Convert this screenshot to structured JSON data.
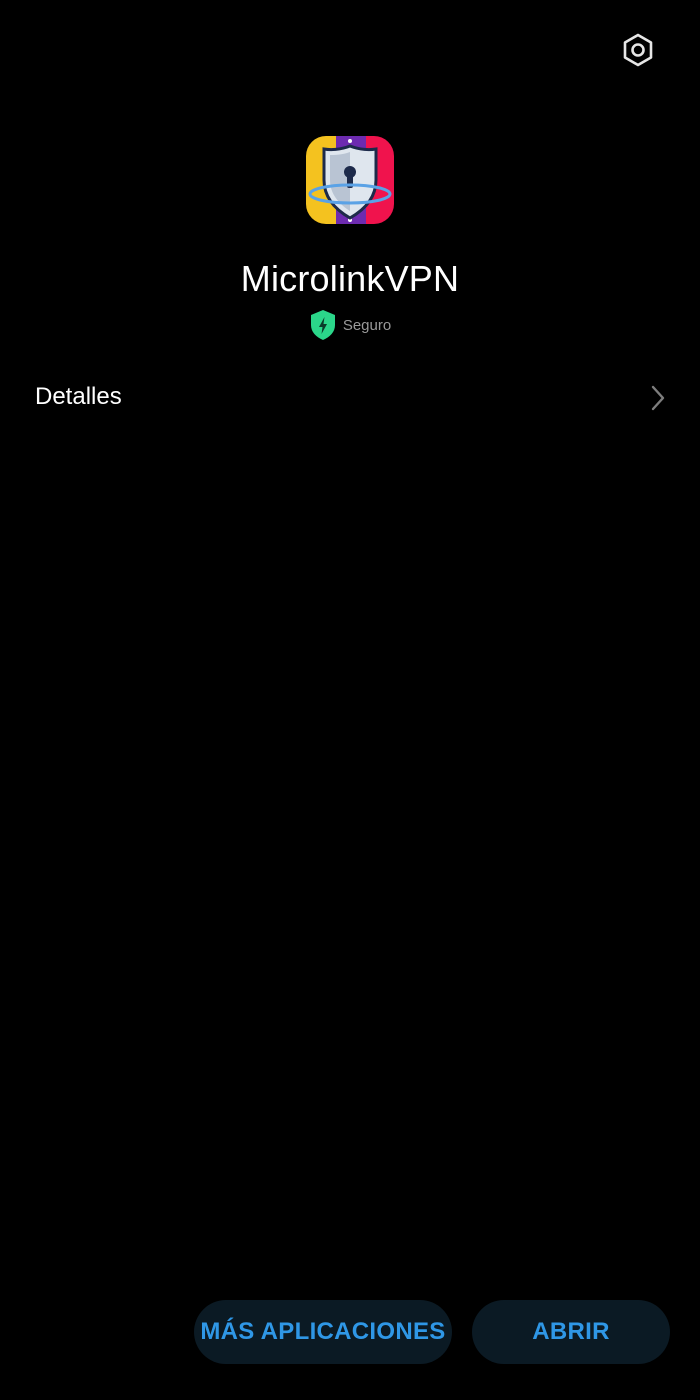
{
  "header": {
    "settings_icon": "settings-hexagon-icon"
  },
  "app": {
    "name": "MicrolinkVPN",
    "icon": "app-shield-keyhole-icon",
    "safety_label": "Seguro",
    "safety_icon": "shield-bolt-icon"
  },
  "details": {
    "label": "Detalles",
    "chevron_icon": "chevron-right-icon"
  },
  "actions": {
    "more_apps_label": "MÁS APLICACIONES",
    "open_label": "ABRIR"
  },
  "colors": {
    "background": "#000000",
    "accent": "#2f97e6",
    "button_bg": "#0b1a24",
    "safety_green": "#2bd68a",
    "secondary_text": "#9a9a9a"
  }
}
